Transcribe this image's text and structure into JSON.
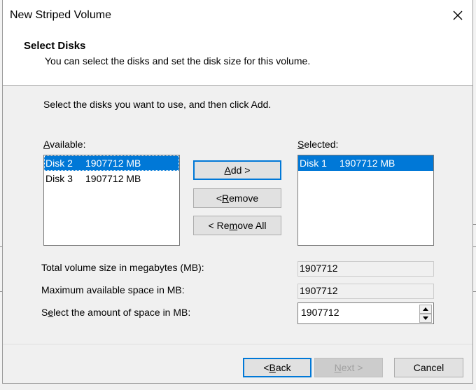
{
  "window": {
    "title": "New Striped Volume"
  },
  "header": {
    "title": "Select Disks",
    "subtitle": "You can select the disks and set the disk size for this volume."
  },
  "instructions": "Select the disks you want to use, and then click Add.",
  "available": {
    "label_pre": "",
    "label_key": "A",
    "label_post": "vailable:",
    "items": [
      {
        "disk": "Disk 2",
        "size": "1907712 MB",
        "selected": true
      },
      {
        "disk": "Disk 3",
        "size": "1907712 MB",
        "selected": false
      }
    ]
  },
  "selected": {
    "label_pre": "",
    "label_key": "S",
    "label_post": "elected:",
    "items": [
      {
        "disk": "Disk 1",
        "size": "1907712 MB",
        "selected": true
      }
    ]
  },
  "buttons": {
    "add": {
      "pre": "",
      "key": "A",
      "post": "dd >"
    },
    "remove": {
      "pre": "< ",
      "key": "R",
      "post": "emove"
    },
    "remove_all": {
      "pre": "< Re",
      "key": "m",
      "post": "ove All"
    },
    "back": {
      "pre": "< ",
      "key": "B",
      "post": "ack"
    },
    "next": {
      "pre": "",
      "key": "N",
      "post": "ext >"
    },
    "cancel": "Cancel"
  },
  "fields": {
    "total_label": "Total volume size in megabytes (MB):",
    "total_value": "1907712",
    "max_label": "Maximum available space in MB:",
    "max_value": "1907712",
    "amount_label_pre": "S",
    "amount_label_key": "e",
    "amount_label_post": "lect the amount of space in MB:",
    "amount_value": "1907712"
  },
  "icons": {
    "close": "close-icon",
    "spin_up": "chevron-up-icon",
    "spin_down": "chevron-down-icon"
  },
  "colors": {
    "selection": "#0078d7",
    "default_button_border": "#0078d7"
  }
}
